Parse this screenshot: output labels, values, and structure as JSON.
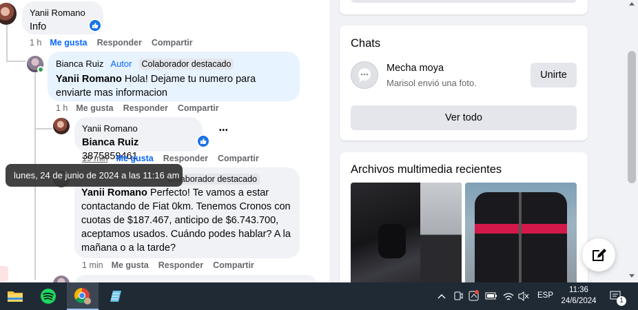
{
  "comments": [
    {
      "author": "Yanii Romano",
      "text": "Info",
      "actions": {
        "time": "1 h",
        "like": "Me gusta",
        "reply": "Responder",
        "share": "Compartir"
      }
    },
    {
      "author": "Bianca Ruiz",
      "author_tag": "Autor",
      "top_tag": "Colaborador destacado",
      "mention": "Yanii Romano",
      "text": "Hola! Dejame tu numero para enviarte mas informacion",
      "actions": {
        "time": "1 h",
        "like": "Me gusta",
        "reply": "Responder",
        "share": "Compartir"
      }
    },
    {
      "author": "Yanii Romano",
      "mention": "Bianca Ruiz",
      "text": "3875859461",
      "more": "•••",
      "actions": {
        "time": "19 min",
        "like": "Me gusta",
        "reply": "Responder",
        "share": "Compartir"
      }
    },
    {
      "top_tag": "Colaborador destacado",
      "mention": "Yanii Romano",
      "text": "Perfecto! Te vamos a estar contactando de Fiat 0km. Tenemos Cronos con cuotas de $187.467, anticipo de $6.743.700, aceptamos usados. Cuándo podes hablar? A la mañana o a la tarde?",
      "actions": {
        "time": "1 min",
        "like": "Me gusta",
        "reply": "Responder",
        "share": "Compartir"
      }
    }
  ],
  "tooltip": "lunes, 24 de junio de 2024 a las 11:16 am",
  "chats": {
    "title": "Chats",
    "items": [
      {
        "name": "Mecha moya",
        "preview": "Marisol envió una foto.",
        "button": "Unirte"
      }
    ],
    "see_all": "Ver todo"
  },
  "media": {
    "title": "Archivos multimedia recientes"
  },
  "taskbar": {
    "apps": [
      "file-explorer",
      "spotify",
      "chrome",
      "notepad"
    ],
    "language": "ESP",
    "time": "11:36",
    "date": "24/6/2024",
    "notification_count": "1"
  },
  "colors": {
    "link_blue": "#0866ff",
    "like_blue": "#1b74e4",
    "taskbar": "#1f2a35"
  }
}
